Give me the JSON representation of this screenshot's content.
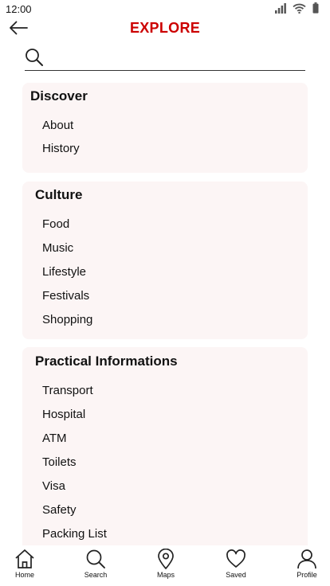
{
  "status_bar": {
    "time": "12:00",
    "icons": [
      "signal-icon",
      "wifi-icon",
      "battery-icon"
    ]
  },
  "header": {
    "title": "EXPLORE",
    "back_icon": "arrow-left-icon"
  },
  "search": {
    "value": "",
    "placeholder": "",
    "icon": "search-icon"
  },
  "colors": {
    "accent": "#cc0000",
    "card_background": "#fcf5f5"
  },
  "sections": [
    {
      "title": "Discover",
      "items": [
        "About",
        "History"
      ]
    },
    {
      "title": "Culture",
      "items": [
        "Food",
        "Music",
        "Lifestyle",
        "Festivals",
        "Shopping"
      ]
    },
    {
      "title": "Practical Informations",
      "items": [
        "Transport",
        "Hospital",
        "ATM",
        "Toilets",
        "Visa",
        "Safety",
        "Packing List"
      ]
    }
  ],
  "bottom_nav": [
    {
      "label": "Home",
      "icon": "home-icon"
    },
    {
      "label": "Search",
      "icon": "search-icon"
    },
    {
      "label": "Maps",
      "icon": "map-pin-icon"
    },
    {
      "label": "Saved",
      "icon": "heart-icon"
    },
    {
      "label": "Profile",
      "icon": "user-icon"
    }
  ]
}
